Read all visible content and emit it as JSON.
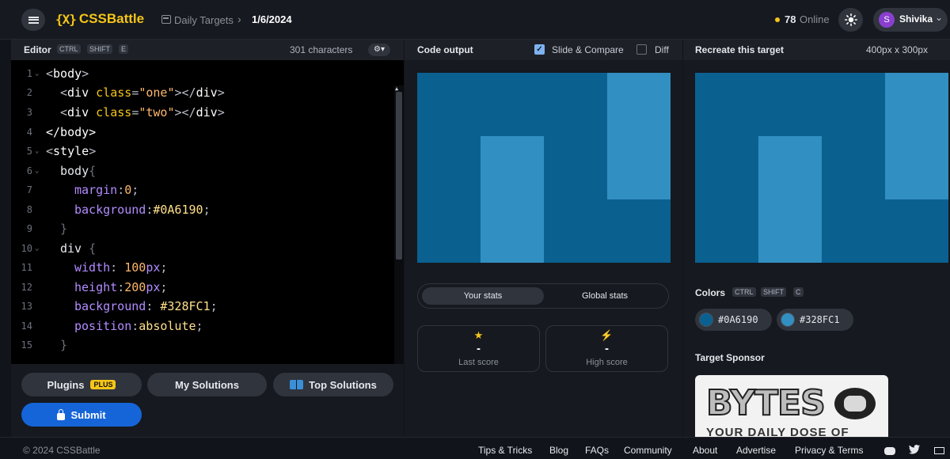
{
  "header": {
    "logo_mark": "{X}",
    "logo_text": "CSSBattle",
    "breadcrumb_section": "Daily Targets",
    "breadcrumb_sep": "›",
    "breadcrumb_current": "1/6/2024",
    "online_count": "78",
    "online_label": "Online",
    "theme_icon": "sun-icon",
    "user_initial": "S",
    "user_name": "Shivika",
    "user_chevron": "⌄"
  },
  "editor": {
    "title": "Editor",
    "shortcut": [
      "CTRL",
      "SHIFT",
      "E"
    ],
    "char_count": "301 characters",
    "settings_icon": "⚙▾",
    "line_numbers": [
      "1",
      "2",
      "3",
      "4",
      "5",
      "6",
      "7",
      "8",
      "9",
      "10",
      "11",
      "12",
      "13",
      "14",
      "15"
    ],
    "code": {
      "l1_open": "<",
      "l1_tag": "body",
      "l1_close": ">",
      "div": "div",
      "class": "class",
      "eq": "=",
      "l2_str": "\"one\"",
      "l3_str": "\"two\"",
      "l4_tag": "</body>",
      "style": "style",
      "body_sel": "body",
      "brace_open": "{",
      "brace_close": "}",
      "div_sel": "div",
      "margin_prop": "margin",
      "margin_val": "0",
      "background_prop": "background",
      "bg1_val": "#0A6190",
      "width_prop": "width",
      "width_num": "100",
      "height_prop": "height",
      "height_num": "200",
      "px": "px",
      "bg2_val": "#328FC1",
      "position_prop": "position",
      "position_val": "absolute",
      "colon": ":",
      "semi": ";"
    },
    "buttons": {
      "plugins": "Plugins",
      "plus": "PLUS",
      "my_solutions": "My Solutions",
      "top_solutions": "Top Solutions",
      "submit": "Submit"
    }
  },
  "output": {
    "title": "Code output",
    "slide_compare": "Slide & Compare",
    "slide_compare_checked": true,
    "diff": "Diff",
    "diff_checked": false,
    "check_mark": "✓",
    "stats_tabs": [
      "Your stats",
      "Global stats"
    ],
    "last_score_icon": "★",
    "last_score_value": "-",
    "last_score_label": "Last score",
    "high_score_icon": "⚡",
    "high_score_value": "-",
    "high_score_label": "High score"
  },
  "target": {
    "title": "Recreate this target",
    "dimensions": "400px x 300px",
    "colors_label": "Colors",
    "colors_shortcut": [
      "CTRL",
      "SHIFT",
      "C"
    ],
    "colors": [
      {
        "hex": "#0A6190",
        "label": "#0A6190"
      },
      {
        "hex": "#328FC1",
        "label": "#328FC1"
      }
    ],
    "sponsor_label": "Target Sponsor",
    "sponsor_name": "BYTES",
    "sponsor_tagline": "YOUR DAILY DOSE OF"
  },
  "footer": {
    "copyright": "© 2024 CSSBattle",
    "links": [
      "Tips & Tricks",
      "Blog",
      "FAQs",
      "Community",
      "About",
      "Advertise",
      "Privacy & Terms"
    ],
    "twitter_icon": "twitter-icon"
  },
  "colors": {
    "accent": "#f5c518",
    "submit": "#1565d8",
    "canvas_bg": "#0A6190",
    "canvas_block": "#328FC1"
  }
}
